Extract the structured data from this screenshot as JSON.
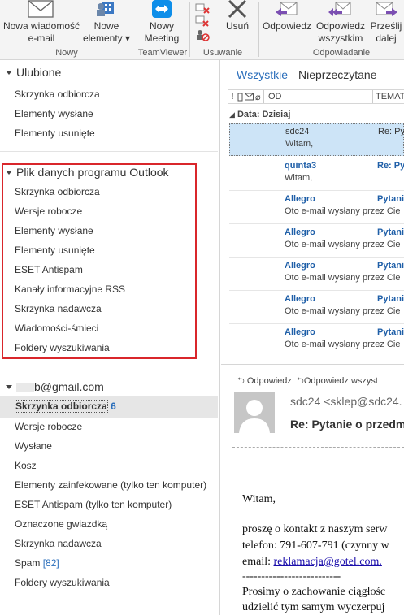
{
  "ribbon": {
    "buttons": {
      "new_email": [
        "Nowa wiadomość",
        "e-mail"
      ],
      "new_items": [
        "Nowe",
        "elementy ▾"
      ],
      "new_meeting": [
        "Nowy",
        "Meeting"
      ],
      "delete": "Usuń",
      "reply": "Odpowiedz",
      "reply_all": [
        "Odpowiedz",
        "wszystkim"
      ],
      "forward": [
        "Prześlij",
        "dalej"
      ]
    },
    "groups": {
      "new": "Nowy",
      "teamviewer": "TeamViewer",
      "delete": "Usuwanie",
      "respond": "Odpowiadanie"
    }
  },
  "favorites": {
    "title": "Ulubione",
    "items": [
      "Skrzynka odbiorcza",
      "Elementy wysłane",
      "Elementy usunięte"
    ]
  },
  "datafile": {
    "title": "Plik danych programu Outlook",
    "items": [
      "Skrzynka odbiorcza",
      "Wersje robocze",
      "Elementy wysłane",
      "Elementy usunięte",
      "ESET Antispam",
      "Kanały informacyjne RSS",
      "Skrzynka nadawcza",
      "Wiadomości-śmieci",
      "Foldery wyszukiwania"
    ]
  },
  "gmail": {
    "title": "b@gmail.com",
    "inbox_label": "Skrzynka odbiorcza",
    "inbox_count": "6",
    "items": [
      "Wersje robocze",
      "Wysłane",
      "Kosz",
      "Elementy zainfekowane (tylko ten komputer)",
      "ESET Antispam (tylko ten komputer)",
      "Oznaczone gwiazdką",
      "Skrzynka nadawcza"
    ],
    "spam_label": "Spam",
    "spam_count": "[82]",
    "search_folders": "Foldery wyszukiwania"
  },
  "mail_list": {
    "filter_all": "Wszystkie",
    "filter_unread": "Nieprzeczytane",
    "columns": {
      "from": "OD",
      "subject": "TEMAT"
    },
    "date_group": "Data: Dzisiaj",
    "messages": [
      {
        "from": "sdc24",
        "subject": "Re: Pyta",
        "preview": "Witam,"
      },
      {
        "from": "quinta3",
        "subject": "Re:  Pyta",
        "preview": "Witam,"
      },
      {
        "from": "Allegro",
        "subject": "Pytanie",
        "preview": "Oto e-mail wysłany przez Cie"
      },
      {
        "from": "Allegro",
        "subject": "Pytanie",
        "preview": "Oto e-mail wysłany przez Cie"
      },
      {
        "from": "Allegro",
        "subject": "Pytanie",
        "preview": "Oto e-mail wysłany przez Cie"
      },
      {
        "from": "Allegro",
        "subject": "Pytanie",
        "preview": "Oto e-mail wysłany przez Cie"
      },
      {
        "from": "Allegro",
        "subject": "Pytanie",
        "preview": "Oto e-mail wysłany przez Cie"
      }
    ]
  },
  "reading_pane": {
    "reply": "Odpowiedz",
    "reply_all": "Odpowiedz wszyst",
    "from": "sdc24 <sklep@sdc24.",
    "subject": "Re: Pytanie o przedm",
    "body": {
      "greeting": "Witam,",
      "line1": "proszę o kontakt z naszym serw",
      "line2": "telefon: 791-607-791 (czynny w",
      "email_label": "email: ",
      "email_link": "reklamacja@gotel.com.",
      "dashes": "--------------------------",
      "line3": "Prosimy o zachowanie ciągłośc",
      "line4": "udzielić tym samym wyczerpuj"
    }
  },
  "colors": {
    "accent": "#2a6ebb",
    "highlight_box": "#d9262b",
    "selected_mail": "#cde4f7"
  }
}
